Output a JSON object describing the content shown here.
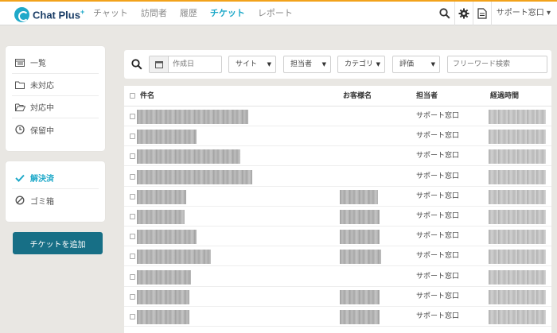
{
  "app": {
    "logo_text": "Chat Plus",
    "logo_plus": "+"
  },
  "nav": {
    "items": [
      "チャット",
      "訪問者",
      "履歴",
      "チケット",
      "レポート"
    ],
    "active_index": 3
  },
  "topbar": {
    "user_menu": "サポート窓口 ▾"
  },
  "sidebar": {
    "group1": [
      {
        "label": "一覧",
        "icon": "list-icon"
      },
      {
        "label": "未対応",
        "icon": "folder-icon"
      },
      {
        "label": "対応中",
        "icon": "folder-open-icon"
      },
      {
        "label": "保留中",
        "icon": "clock-icon"
      }
    ],
    "group2": [
      {
        "label": "解決済",
        "icon": "check-icon",
        "active": true
      },
      {
        "label": "ゴミ箱",
        "icon": "ban-icon"
      }
    ],
    "add_button": "チケットを追加"
  },
  "filters": {
    "date_placeholder": "作成日",
    "site": "サイト",
    "assignee": "担当者",
    "category": "カテゴリ",
    "rating": "評価",
    "freeword_placeholder": "フリーワード検索"
  },
  "table": {
    "headers": {
      "subject": "件名",
      "customer": "お客様名",
      "assignee": "担当者",
      "elapsed": "経過時間"
    },
    "rows": [
      {
        "assignee": "サポート窓口"
      },
      {
        "assignee": "サポート窓口"
      },
      {
        "assignee": "サポート窓口"
      },
      {
        "assignee": "サポート窓口"
      },
      {
        "assignee": "サポート窓口"
      },
      {
        "assignee": "サポート窓口"
      },
      {
        "assignee": "サポート窓口"
      },
      {
        "assignee": "サポート窓口"
      },
      {
        "assignee": "サポート窓口"
      },
      {
        "assignee": "サポート窓口"
      },
      {
        "assignee": "サポート窓口"
      }
    ]
  },
  "colors": {
    "accent": "#1fa9c9",
    "top_border": "#f2a21b",
    "button": "#176f86",
    "background": "#e9e7e3"
  }
}
